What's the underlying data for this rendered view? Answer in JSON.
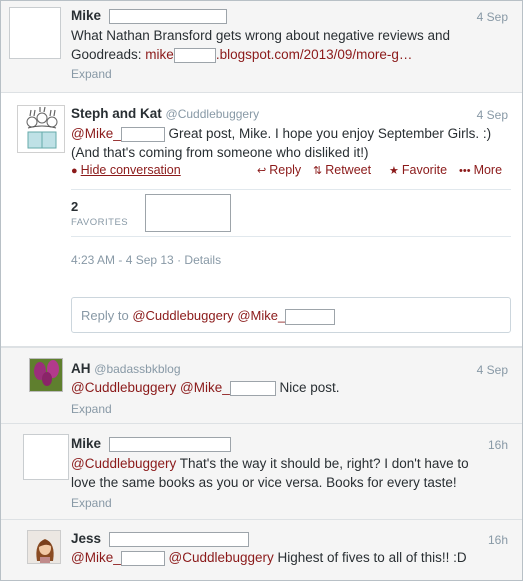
{
  "tweets": [
    {
      "name": "Mike",
      "time": "4 Sep",
      "text_line1": "What Nathan Bransford gets wrong about negative reviews and",
      "text_line2_prefix": "Goodreads: ",
      "link_a": "mike",
      "link_b": ".blogspot.com/2013/09/more-g…",
      "expand": "Expand"
    },
    {
      "name": "Steph and Kat",
      "handle": "@Cuddlebuggery",
      "time": "4 Sep",
      "mention": "@Mike_",
      "text_line1": "Great post, Mike. I hope you enjoy September Girls. :)",
      "text_line2": "(And that's coming from someone who disliked it!)",
      "hide": "Hide conversation",
      "reply": "Reply",
      "retweet": "Retweet",
      "favorite": "Favorite",
      "more": "More",
      "fav_count": "2",
      "fav_label": "FAVORITES",
      "details": "4:23 AM - 4 Sep 13 · Details"
    },
    {
      "name": "AH",
      "handle": "@badassbkblog",
      "time": "4 Sep",
      "mention1": "@Cuddlebuggery",
      "mention2": "@Mike_",
      "text": "Nice post.",
      "expand": "Expand"
    },
    {
      "name": "Mike",
      "time": "16h",
      "mention": "@Cuddlebuggery",
      "text_line1": " That's the way it should be, right? I don't have to",
      "text_line2": "love the same books as you or vice versa. Books for every taste!",
      "expand": "Expand"
    },
    {
      "name": "Jess",
      "time": "16h",
      "mention1": "@Mike_",
      "mention2": "@Cuddlebuggery",
      "text": " Highest of fives to all of this!! :D"
    }
  ],
  "reply_box": {
    "prefix": "Reply to ",
    "mention1": "@Cuddlebuggery",
    "mention2": "@Mike_"
  },
  "colors": {
    "link": "#8b1a1a",
    "muted": "#8899a6"
  }
}
